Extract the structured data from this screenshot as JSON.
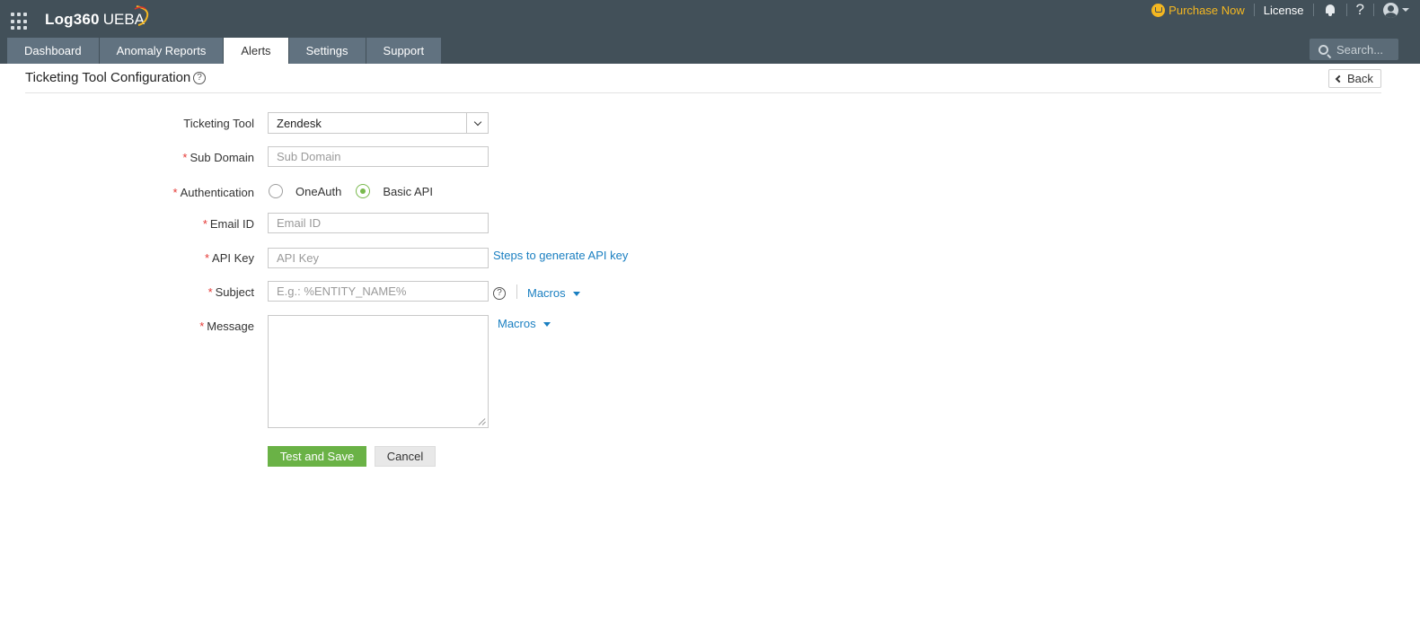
{
  "header": {
    "brand": "Log360",
    "product": "UEBA",
    "purchase_label": "Purchase Now",
    "license_label": "License",
    "help_label": "?",
    "icons": [
      "apps-grid-icon",
      "cart-icon",
      "bell-icon",
      "help-icon",
      "user-icon",
      "caret-down-icon"
    ],
    "colors": {
      "topbar": "#425059",
      "tab": "#617280",
      "purchase": "#f4b721"
    }
  },
  "tabs": [
    {
      "label": "Dashboard",
      "active": false
    },
    {
      "label": "Anomaly Reports",
      "active": false
    },
    {
      "label": "Alerts",
      "active": true
    },
    {
      "label": "Settings",
      "active": false
    },
    {
      "label": "Support",
      "active": false
    }
  ],
  "search": {
    "placeholder": "Search..."
  },
  "page": {
    "title": "Ticketing Tool Configuration",
    "help_icon": "?",
    "back_label": "Back"
  },
  "form": {
    "ticketing_tool": {
      "label": "Ticketing Tool",
      "value": "Zendesk"
    },
    "sub_domain": {
      "label": "Sub Domain",
      "placeholder": "Sub Domain",
      "value": ""
    },
    "authentication": {
      "label": "Authentication",
      "options": [
        {
          "label": "OneAuth",
          "checked": false
        },
        {
          "label": "Basic API",
          "checked": true
        }
      ]
    },
    "email": {
      "label": "Email ID",
      "placeholder": "Email ID",
      "value": ""
    },
    "api_key": {
      "label": "API Key",
      "placeholder": "API Key",
      "value": "",
      "link": "Steps to generate API key"
    },
    "subject": {
      "label": "Subject",
      "placeholder": "E.g.: %ENTITY_NAME%",
      "value": "",
      "help_icon": "?",
      "macros_label": "Macros"
    },
    "message": {
      "label": "Message",
      "value": "",
      "macros_label": "Macros"
    },
    "required_mark": "*",
    "save_label": "Test and Save",
    "cancel_label": "Cancel",
    "colors": {
      "required": "#e53935",
      "primary_button": "#6ab246",
      "link": "#1a7fc1",
      "radio_checked": "#79b94d"
    }
  }
}
